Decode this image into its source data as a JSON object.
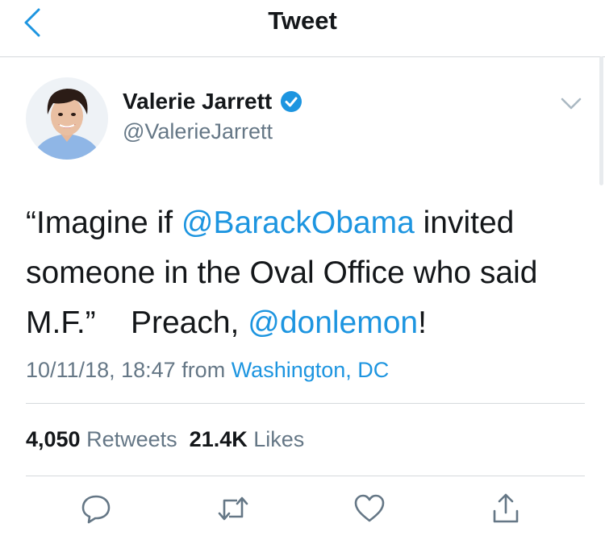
{
  "header": {
    "title": "Tweet"
  },
  "tweet": {
    "author": {
      "name": "Valerie Jarrett",
      "handle": "@ValerieJarrett"
    },
    "text": {
      "part1": "“Imagine if ",
      "mention1": "@BarackObama",
      "part2": " invited someone in the Oval Office who said M.F.”    Preach, ",
      "mention2": "@donlemon",
      "part3": "!"
    },
    "timestamp": "10/11/18, 18:47",
    "from_label": "from",
    "location": "Washington, DC",
    "stats": {
      "retweets_count": "4,050",
      "retweets_label": "Retweets",
      "likes_count": "21.4K",
      "likes_label": "Likes"
    }
  },
  "colors": {
    "accent": "#1d95e0",
    "text": "#14171a",
    "muted": "#657786",
    "divider": "#d5d9dc"
  },
  "icons": [
    "back-chevron-icon",
    "verified-badge-icon",
    "chevron-down-icon",
    "reply-icon",
    "retweet-icon",
    "like-icon",
    "share-icon"
  ]
}
